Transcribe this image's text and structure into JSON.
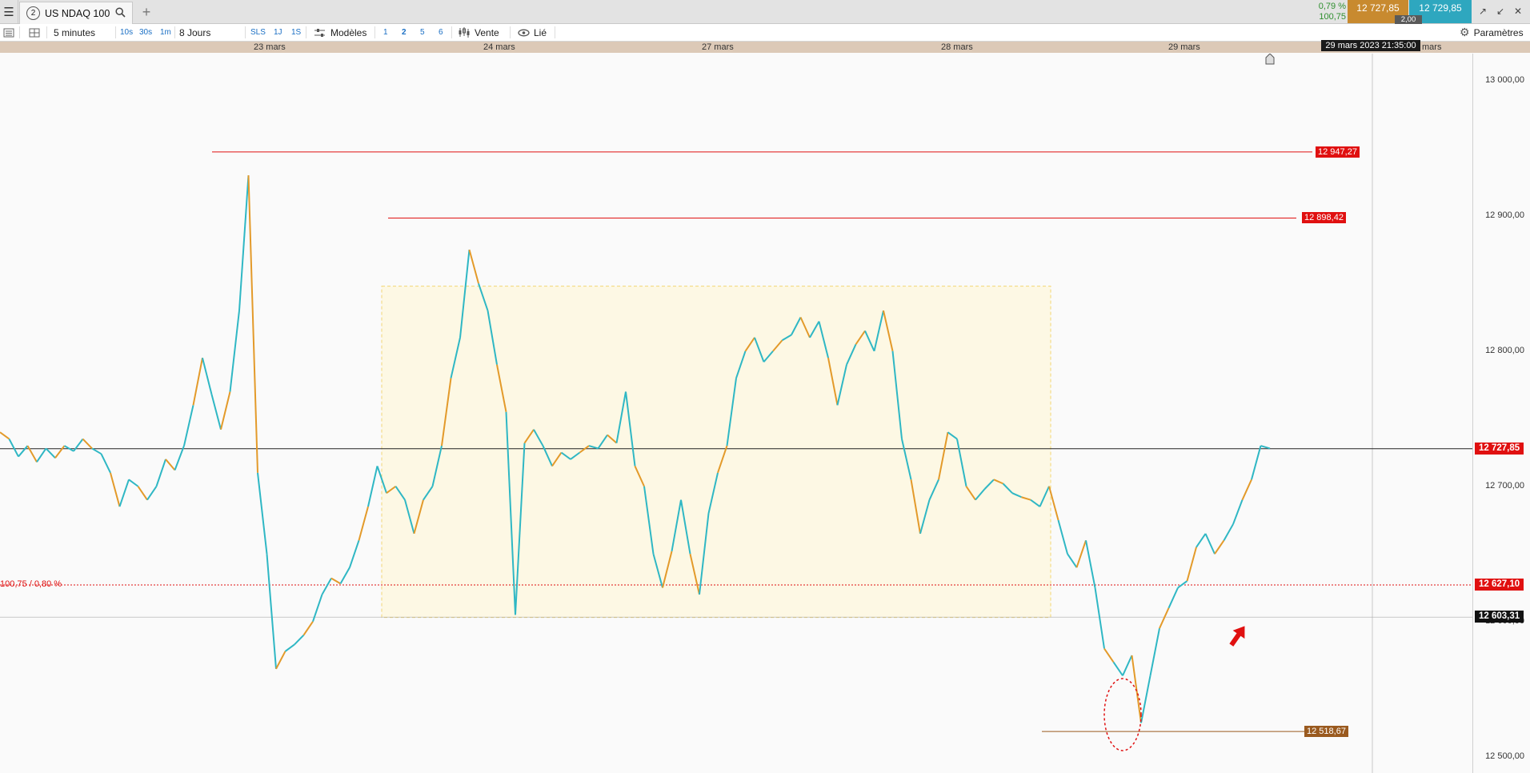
{
  "tabbar": {
    "menu_icon": "hamburger-icon",
    "tab_number": "2",
    "tab_title": "US NDAQ 100",
    "search_icon": "search-icon",
    "add_tab": "+",
    "change_pct": "0,79 %",
    "change_val": "100,75",
    "bid": "12 727,85",
    "ask": "12 729,85",
    "spread": "2,00",
    "window_icons": [
      "detach-icon",
      "collapse-icon",
      "close-icon"
    ]
  },
  "toolbar": {
    "timeframe": "5 minutes",
    "quick_tf": [
      "10s",
      "30s",
      "1m"
    ],
    "period": "8 Jours",
    "chart_modes": [
      "SLS",
      "1J",
      "1S"
    ],
    "models_label": "Modèles",
    "layouts": [
      "1",
      "2",
      "5",
      "6"
    ],
    "active_layout": "2",
    "sell_label": "Vente",
    "linked_label": "Lié",
    "settings_label": "Paramètres"
  },
  "date_axis": {
    "labels": [
      "23 mars",
      "24 mars",
      "27 mars",
      "28 mars",
      "29 mars",
      "mars"
    ],
    "cursor_time": "29 mars 2023 21:35:00"
  },
  "price_axis": {
    "labels": [
      "13 000,00",
      "12 900,00",
      "12 800,00",
      "12 700,00",
      "12 600,00",
      "12 500,00"
    ]
  },
  "chart_data": {
    "type": "line",
    "instrument": "US NDAQ 100",
    "interval": "5 minutes",
    "ylim": [
      12488,
      13020
    ],
    "x": [
      "23 mars",
      "24 mars",
      "27 mars",
      "28 mars",
      "29 mars"
    ],
    "current_price": 12727.85,
    "current_price_label": "12 727,85",
    "levels": [
      {
        "value": 12947.27,
        "label": "12 947,27",
        "color": "#e01010"
      },
      {
        "value": 12898.42,
        "label": "12 898,42",
        "color": "#e01010"
      },
      {
        "value": 12627.1,
        "label": "12 627,10",
        "color": "#e01010"
      },
      {
        "value": 12603.31,
        "label": "12 603,31",
        "color": "#111111"
      },
      {
        "value": 12518.67,
        "label": "12 518,67",
        "color": "#9a5a1f"
      }
    ],
    "change_annotation": "100,75 / 0,80 %",
    "range_box": {
      "top": 12848,
      "bottom": 12603
    },
    "series": [
      {
        "values": [
          12740,
          12735,
          12722,
          12730,
          12718,
          12728,
          12721,
          12730,
          12726,
          12735,
          12728,
          12724,
          12710,
          12685,
          12705,
          12700,
          12690,
          12700,
          12720,
          12712,
          12730,
          12760,
          12795,
          12768,
          12742,
          12770,
          12830,
          12930,
          12710,
          12650,
          12565,
          12578,
          12583,
          12590,
          12600,
          12620,
          12632,
          12628,
          12640,
          12660,
          12685,
          12715,
          12695,
          12700,
          12690,
          12665,
          12690,
          12700,
          12730,
          12780,
          12810,
          12875,
          12850,
          12830,
          12790,
          12755,
          12605,
          12732,
          12742,
          12730,
          12715,
          12725,
          12720,
          12725,
          12730,
          12728,
          12738,
          12732,
          12770,
          12715,
          12700,
          12650,
          12625,
          12652,
          12690,
          12650,
          12620,
          12680,
          12710,
          12730,
          12780,
          12800,
          12810,
          12792,
          12800,
          12808,
          12812,
          12825,
          12810,
          12822,
          12795,
          12760,
          12790,
          12805,
          12815,
          12800,
          12830,
          12800,
          12735,
          12705,
          12665,
          12690,
          12705,
          12740,
          12735,
          12700,
          12690,
          12698,
          12705,
          12702,
          12695,
          12692,
          12690,
          12685,
          12700,
          12675,
          12650,
          12640,
          12660,
          12625,
          12580,
          12570,
          12560,
          12575,
          12525,
          12560,
          12595,
          12610,
          12625,
          12630,
          12655,
          12665,
          12650,
          12660,
          12672,
          12690,
          12705,
          12730,
          12728
        ]
      }
    ]
  }
}
